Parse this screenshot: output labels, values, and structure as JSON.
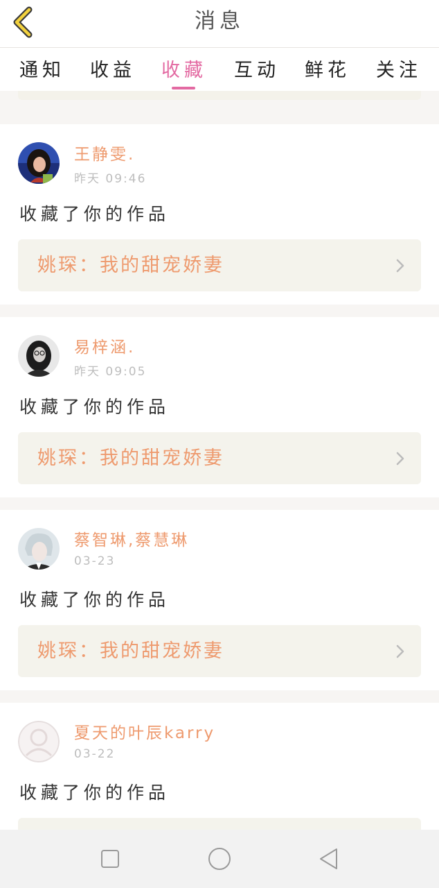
{
  "header": {
    "title": "消息"
  },
  "tabs": [
    {
      "label": "通知",
      "active": false
    },
    {
      "label": "收益",
      "active": false
    },
    {
      "label": "收藏",
      "active": true
    },
    {
      "label": "互动",
      "active": false
    },
    {
      "label": "鲜花",
      "active": false
    },
    {
      "label": "关注",
      "active": false
    }
  ],
  "colors": {
    "accent": "#e36aa2",
    "name": "#ee9a6e",
    "time": "#bdbdbd",
    "card_bg": "#f4f3ec",
    "page_bg": "#f7f5f3"
  },
  "messages": [
    {
      "name": "王静雯.",
      "time": "昨天 09:46",
      "action": "收藏了你的作品",
      "work_title": "姚琛：我的甜宠娇妻",
      "avatar": "avatar-photo-girl-dark-hair"
    },
    {
      "name": "易梓涵.",
      "time": "昨天 09:05",
      "action": "收藏了你的作品",
      "work_title": "姚琛：我的甜宠娇妻",
      "avatar": "avatar-photo-girl-bw"
    },
    {
      "name": "蔡智琳,蔡慧琳",
      "time": "03-23",
      "action": "收藏了你的作品",
      "work_title": "姚琛：我的甜宠娇妻",
      "avatar": "avatar-photo-silver-hair"
    },
    {
      "name": "夏天的叶辰karry",
      "time": "03-22",
      "action": "收藏了你的作品",
      "work_title": "",
      "avatar": "avatar-default-user"
    }
  ],
  "navbar": {
    "icons": [
      "square-recent-icon",
      "circle-home-icon",
      "triangle-back-icon"
    ]
  }
}
